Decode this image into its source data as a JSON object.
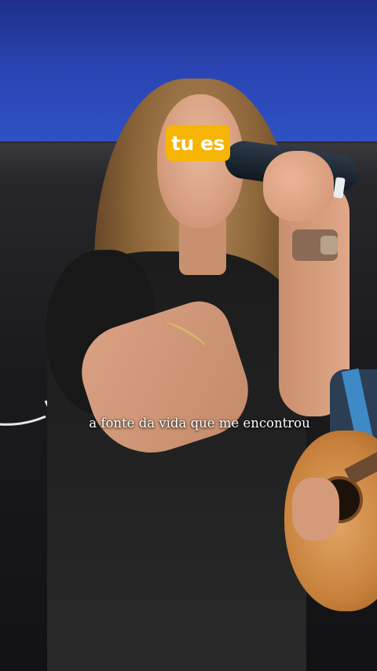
{
  "overlay": {
    "current_word": "tu es",
    "lyric_line": "a fonte da vida que me encontrou"
  },
  "colors": {
    "badge_background": "#f6b404",
    "badge_text": "#ffffff",
    "lyric_text": "#ffffff",
    "backdrop_blue": "#2a46b4"
  },
  "scene": {
    "subjects": [
      "singer-with-microphone",
      "guitarist-partial"
    ]
  }
}
